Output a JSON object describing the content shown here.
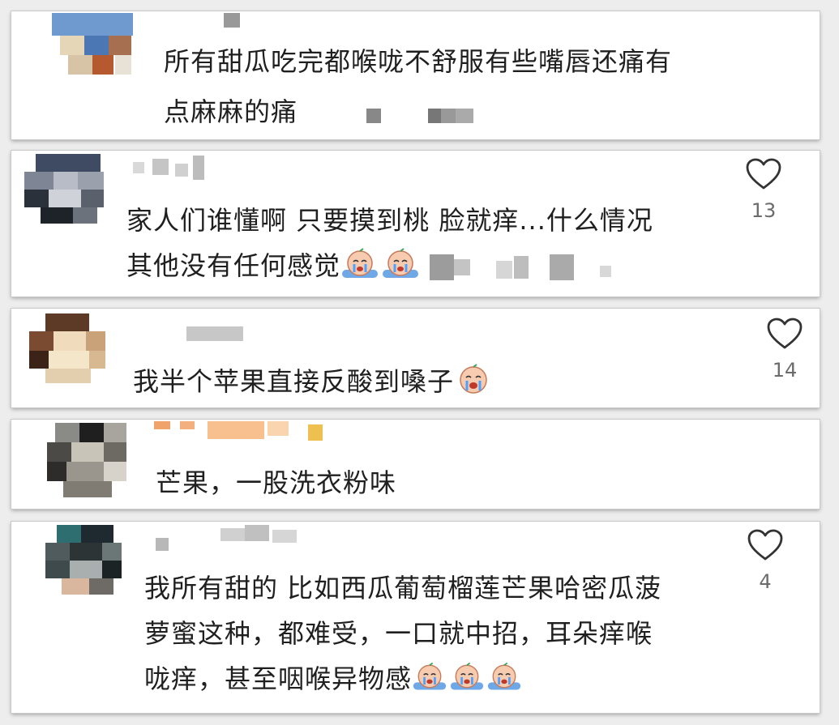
{
  "colors": {
    "text": "#1f1f1f",
    "count": "#6b6b6b",
    "card": "#ffffff",
    "background": "#ededed"
  },
  "icons": {
    "like": "heart-icon",
    "emoji": "crying-face-icon"
  },
  "comments": [
    {
      "text_lines": [
        "所有甜瓜吃完都喉咙不舒服有些嘴唇还痛有",
        "点麻麻的痛"
      ],
      "likes": ""
    },
    {
      "text_lines": [
        "家人们谁懂啊 只要摸到桃 脸就痒...什么情况",
        "其他没有任何感觉"
      ],
      "likes": "13"
    },
    {
      "text_lines": [
        "我半个苹果直接反酸到嗓子"
      ],
      "likes": "14"
    },
    {
      "text_lines": [
        "芒果，一股洗衣粉味"
      ],
      "likes": ""
    },
    {
      "text_lines": [
        "我所有甜的 比如西瓜葡萄榴莲芒果哈密瓜菠",
        "萝蜜这种，都难受，一口就中招，耳朵痒喉",
        "咙痒，甚至咽喉异物感"
      ],
      "likes": "4"
    }
  ]
}
